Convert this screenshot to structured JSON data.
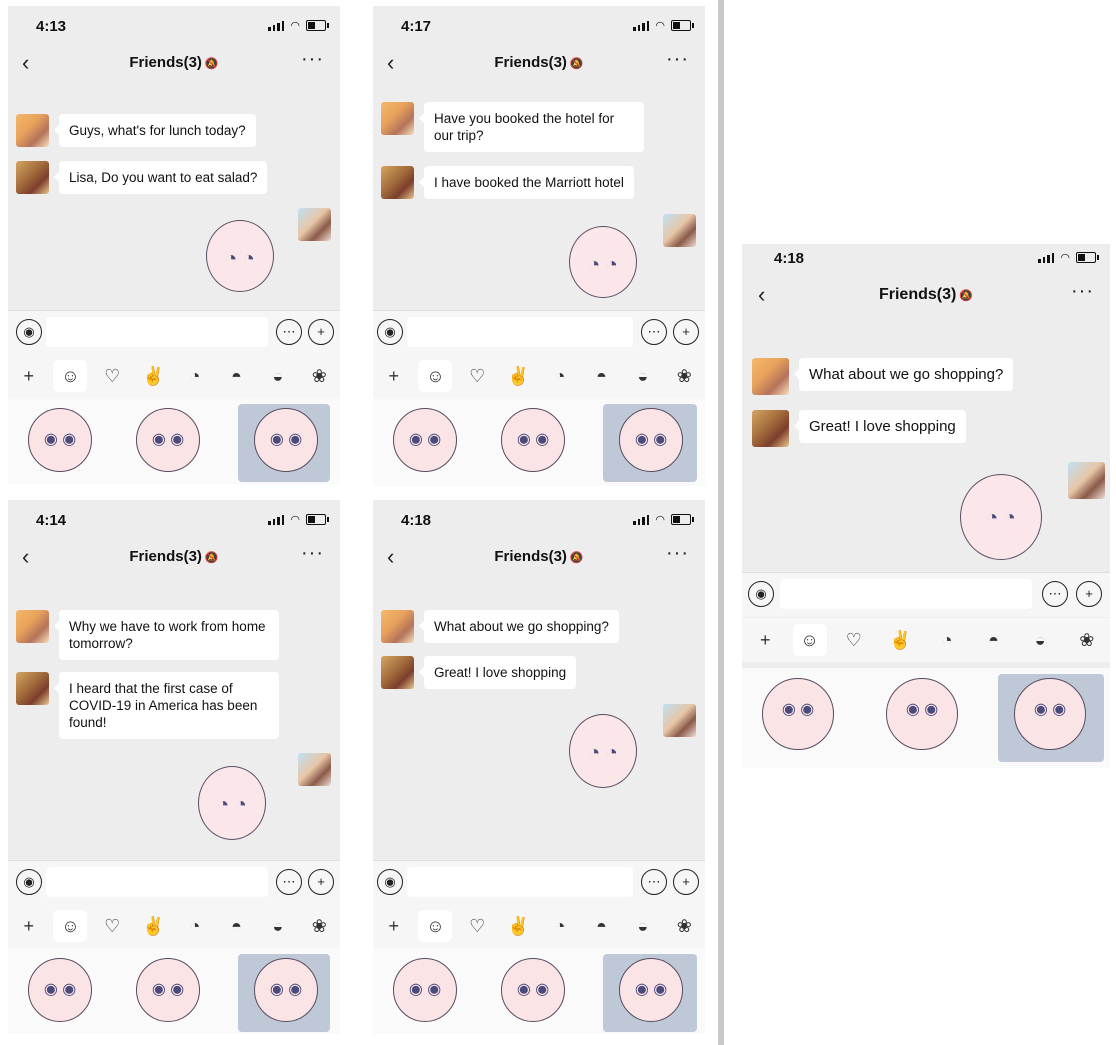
{
  "chat_title": "Friends(3)",
  "screens": [
    {
      "time": "4:13",
      "messages": [
        {
          "text": "Guys, what's for lunch today?"
        },
        {
          "text": "Lisa, Do you want to eat salad?"
        }
      ]
    },
    {
      "time": "4:17",
      "messages": [
        {
          "text": "Have you booked the hotel for our trip?"
        },
        {
          "text": "I have booked the Marriott hotel"
        }
      ]
    },
    {
      "time": "4:14",
      "messages": [
        {
          "text": "Why we have to work from home tomorrow?"
        },
        {
          "text": "I heard that the first case of COVID-19 in America has been found!"
        }
      ]
    },
    {
      "time": "4:18",
      "messages": [
        {
          "text": "What about we go shopping?"
        },
        {
          "text": "Great! I love shopping"
        }
      ]
    },
    {
      "time": "4:18",
      "messages": [
        {
          "text": "What about we go shopping?"
        },
        {
          "text": "Great! I love shopping"
        }
      ]
    }
  ],
  "icons": {
    "back": "chevron-left-icon",
    "more": "more-dots-icon",
    "voice": "voice-icon",
    "keyboard": "keyboard-icon",
    "add": "plus-circle-icon",
    "tray": [
      "plus-icon",
      "emoji-icon",
      "heart-icon",
      "sticker-peace-icon",
      "sticker-bird-icon",
      "sticker-sunglasses-icon",
      "sticker-hat-icon",
      "sticker-cat-icon"
    ]
  },
  "colors": {
    "background": "#ededed",
    "bubble": "#ffffff"
  }
}
